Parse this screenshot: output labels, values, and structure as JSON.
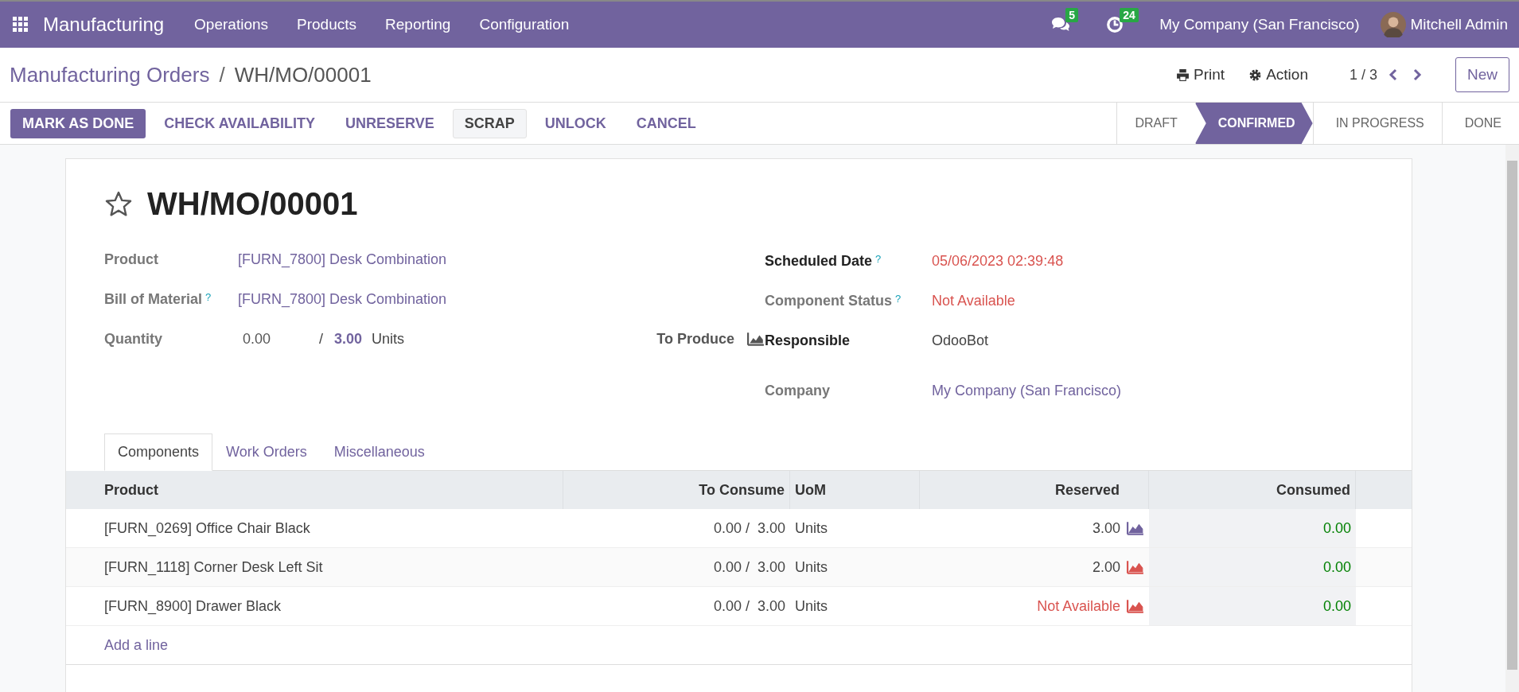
{
  "navbar": {
    "app": "Manufacturing",
    "menus": [
      "Operations",
      "Products",
      "Reporting",
      "Configuration"
    ],
    "messages": "5",
    "activities": "24",
    "company": "My Company (San Francisco)",
    "user": "Mitchell Admin"
  },
  "breadcrumb": {
    "parent": "Manufacturing Orders",
    "separator": "/",
    "current": "WH/MO/00001"
  },
  "actions": {
    "print": "Print",
    "action": "Action",
    "pager": "1 / 3",
    "new": "New"
  },
  "buttons": [
    {
      "label": "MARK AS DONE",
      "kind": "primary"
    },
    {
      "label": "CHECK AVAILABILITY",
      "kind": "link"
    },
    {
      "label": "UNRESERVE",
      "kind": "link"
    },
    {
      "label": "SCRAP",
      "kind": "secondary"
    },
    {
      "label": "UNLOCK",
      "kind": "link"
    },
    {
      "label": "CANCEL",
      "kind": "link"
    }
  ],
  "stages": [
    {
      "label": "DRAFT",
      "selected": false
    },
    {
      "label": "CONFIRMED",
      "selected": true
    },
    {
      "label": "IN PROGRESS",
      "selected": false
    },
    {
      "label": "DONE",
      "selected": false
    }
  ],
  "record": {
    "title": "WH/MO/00001",
    "starred": false
  },
  "left_fields": [
    {
      "label": "Product",
      "value": "[FURN_7800] Desk Combination",
      "kind": "link"
    },
    {
      "label": "Bill of Material",
      "help_mark": "?",
      "value": "[FURN_7800] Desk Combination",
      "kind": "link"
    }
  ],
  "quantity": {
    "label": "Quantity",
    "produced": "0.00",
    "separator": "/",
    "planned": "3.00",
    "uom": "Units",
    "to_produce": "To Produce"
  },
  "right_fields": [
    {
      "label": "Scheduled Date",
      "help_mark": "?",
      "bold": true,
      "value": "05/06/2023 02:39:48",
      "kind": "alert"
    },
    {
      "label": "Component Status",
      "help_mark": "?",
      "bold": false,
      "value": "Not Available",
      "kind": "alert"
    },
    {
      "label": "Responsible",
      "bold": true,
      "value": "OdooBot",
      "kind": "text"
    },
    {
      "label": "Company",
      "bold": false,
      "value": "My Company (San Francisco)",
      "kind": "link"
    }
  ],
  "tabs": [
    {
      "label": "Components",
      "selected": true
    },
    {
      "label": "Work Orders",
      "selected": false
    },
    {
      "label": "Miscellaneous",
      "selected": false
    }
  ],
  "table": {
    "columns": [
      "Product",
      "To Consume",
      "UoM",
      "Reserved",
      "Consumed"
    ],
    "rows": [
      {
        "product": "[FURN_0269] Office Chair Black",
        "to_consume": "0.00 /  3.00",
        "uom": "Units",
        "reserved": "3.00",
        "available": true,
        "color": "#71639e",
        "consumed": "0.00"
      },
      {
        "product": "[FURN_1118] Corner Desk Left Sit",
        "to_consume": "0.00 /  3.00",
        "uom": "Units",
        "reserved": "2.00",
        "available": true,
        "color": "#d9534f",
        "consumed": "0.00"
      },
      {
        "product": "[FURN_8900] Drawer Black",
        "to_consume": "0.00 /  3.00",
        "uom": "Units",
        "reserved": "Not Available",
        "available": false,
        "color": "#d9534f",
        "consumed": "0.00"
      }
    ],
    "add_line": "Add a line"
  }
}
